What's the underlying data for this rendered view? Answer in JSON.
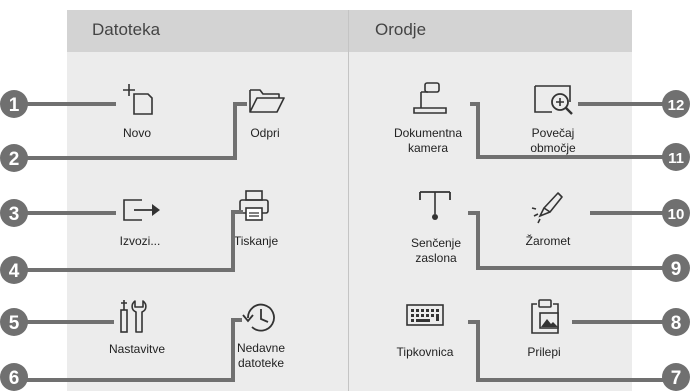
{
  "sections": {
    "file": {
      "title": "Datoteka"
    },
    "tools": {
      "title": "Orodje"
    }
  },
  "items": {
    "new": {
      "label": "Novo",
      "icon": "new-document-icon",
      "number": "1"
    },
    "open": {
      "label": "Odpri",
      "icon": "folder-icon",
      "number": "2"
    },
    "export": {
      "label": "Izvozi...",
      "icon": "export-arrow-icon",
      "number": "3"
    },
    "print": {
      "label": "Tiskanje",
      "icon": "printer-icon",
      "number": "4"
    },
    "settings": {
      "label": "Nastavitve",
      "icon": "wrench-screwdriver-icon",
      "number": "5"
    },
    "recent": {
      "label1": "Nedavne",
      "label2": "datoteke",
      "icon": "clock-history-icon",
      "number": "6"
    },
    "keyboard": {
      "label": "Tipkovnica",
      "icon": "keyboard-icon",
      "number": "7"
    },
    "paste": {
      "label": "Prilepi",
      "icon": "clipboard-image-icon",
      "number": "8"
    },
    "shade": {
      "label1": "Senčenje",
      "label2": "zaslona",
      "icon": "screen-shade-icon",
      "number": "9"
    },
    "spotlight": {
      "label": "Žaromet",
      "icon": "spotlight-icon",
      "number": "10"
    },
    "doccam": {
      "label1": "Dokumentna",
      "label2": "kamera",
      "icon": "document-camera-icon",
      "number": "11"
    },
    "zoom": {
      "label1": "Povečaj",
      "label2": "območje",
      "icon": "zoom-area-icon",
      "number": "12"
    }
  },
  "colors": {
    "callout": "#707070",
    "panel": "#ececec",
    "header": "#d3d3d3"
  }
}
